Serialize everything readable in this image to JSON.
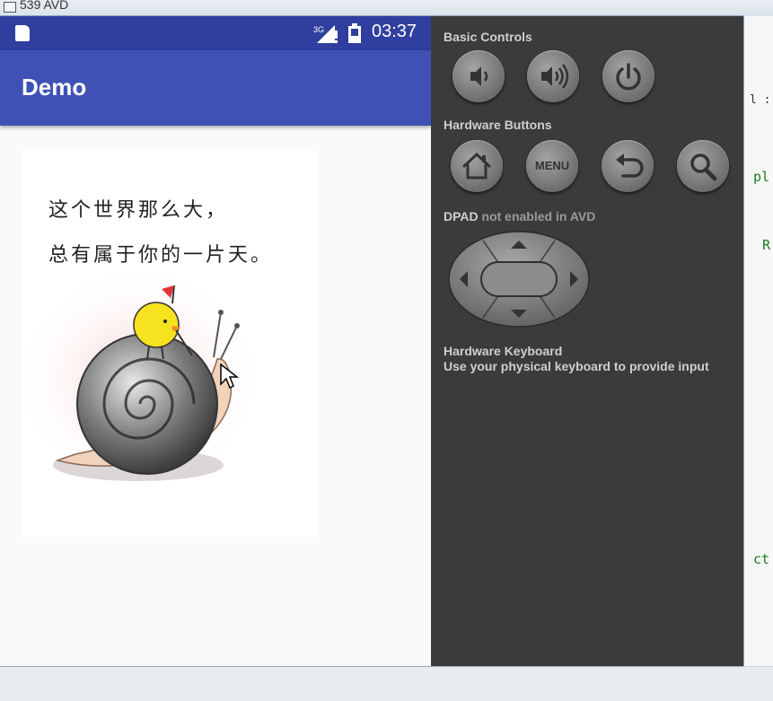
{
  "host": {
    "title": "539 AVD",
    "code_fragments": [
      "l :",
      "pl",
      "R",
      "ct"
    ]
  },
  "statusbar": {
    "network": "3G",
    "time": "03:37"
  },
  "app": {
    "title": "Demo",
    "image_caption": [
      "这个世界那么大，",
      "总有属于你的一片天。"
    ]
  },
  "controls": {
    "basic_label": "Basic Controls",
    "basic_buttons": [
      "volume-down-icon",
      "volume-up-icon",
      "power-icon"
    ],
    "hardware_label": "Hardware Buttons",
    "hardware_buttons": [
      "home-icon",
      "MENU",
      "back-icon",
      "search-icon"
    ],
    "dpad_label": "DPAD",
    "dpad_note": "not enabled in AVD",
    "keyboard_title": "Hardware Keyboard",
    "keyboard_hint": "Use your physical keyboard to provide input"
  },
  "colors": {
    "status_bar": "#303f9f",
    "app_bar": "#3f51b5",
    "panel": "#3b3b3b"
  }
}
